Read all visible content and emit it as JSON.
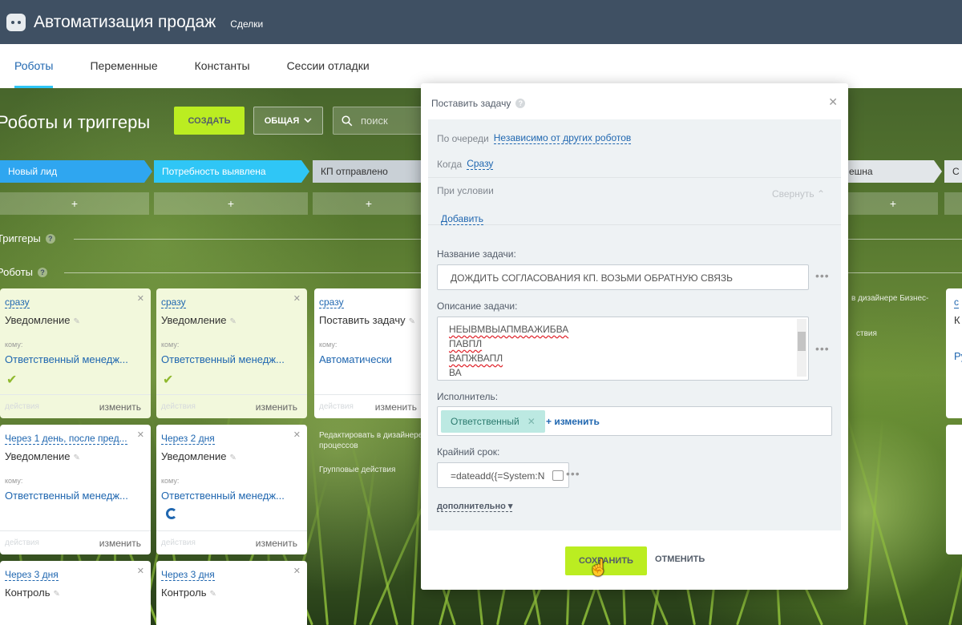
{
  "app": {
    "title": "Автоматизация продаж",
    "section": "Сделки"
  },
  "tabs": [
    {
      "label": "Роботы"
    },
    {
      "label": "Переменные"
    },
    {
      "label": "Константы"
    },
    {
      "label": "Сессии отладки"
    }
  ],
  "toolbar": {
    "page_title": "Роботы и триггеры",
    "create_label": "СОЗДАТЬ",
    "common_label": "ОБЩАЯ",
    "search_placeholder": "поиск"
  },
  "stages": [
    {
      "label": "Новый лид",
      "color": "#2fa6f0"
    },
    {
      "label": "Потребность выявлена",
      "color": "#2fc6f6"
    },
    {
      "label": "КП отправлено",
      "color": "#c9d0d6"
    },
    {
      "label": "ешна",
      "color": "#e2e6e9"
    },
    {
      "label": "С",
      "color": "#e2e6e9"
    }
  ],
  "plus_label": "+",
  "sections": {
    "triggers": "Триггеры",
    "robots": "Роботы"
  },
  "cards": [
    {
      "when": "сразу",
      "name": "Уведомление",
      "to": "кому:",
      "resp": "Ответственный менедж...",
      "acts": "действия",
      "edit": "изменить"
    },
    {
      "when": "сразу",
      "name": "Уведомление",
      "to": "кому:",
      "resp": "Ответственный менедж...",
      "acts": "действия",
      "edit": "изменить"
    },
    {
      "when": "сразу",
      "name": "Поставить задачу",
      "to": "кому:",
      "resp": "Автоматически",
      "acts": "действия",
      "edit": "изменить"
    },
    {
      "when": "Через 1 день, после пред...",
      "name": "Уведомление",
      "to": "кому:",
      "resp": "Ответственный менедж...",
      "acts": "действия",
      "edit": "изменить"
    },
    {
      "when": "Через 2 дня",
      "name": "Уведомление",
      "to": "кому:",
      "resp": "Ответственный менедж...",
      "acts": "действия",
      "edit": "изменить"
    },
    {
      "when": "Через 3 дня",
      "name": "Контроль"
    },
    {
      "when": "Через 3 дня",
      "name": "Контроль"
    }
  ],
  "side": {
    "edit_designer": "Редактировать в дизайнере процессов",
    "group_actions": "Групповые действия",
    "right_designer": "в дизайнере Бизнес-",
    "right_actions": "ствия"
  },
  "right_card": {
    "when": "с",
    "name": "К",
    "resp": "Ру"
  },
  "modal": {
    "title": "Поставить задачу",
    "queue_label": "По очереди",
    "queue_value": "Независимо от других роботов",
    "when_label": "Когда",
    "when_value": "Сразу",
    "condition_label": "При условии",
    "collapse_label": "Свернуть",
    "add_label": "Добавить",
    "task_name_label": "Название задачи:",
    "task_name_value": "ДОЖДИТЬ СОГЛАСОВАНИЯ КП. ВОЗЬМИ ОБРАТНУЮ СВЯЗЬ",
    "description_label": "Описание задачи:",
    "description_lines": [
      "НЕЫВМВЫАПМВАЖИБВА",
      "ПАВПЛ",
      "ВАПЖВАПЛ",
      "ВА"
    ],
    "executor_label": "Исполнитель:",
    "executor_value": "Ответственный",
    "change_label": "+ изменить",
    "deadline_label": "Крайний срок:",
    "deadline_value": "=dateadd({=System:N",
    "more_label": "дополнительно",
    "save_label": "СОХРАНИТЬ",
    "cancel_label": "ОТМЕНИТЬ"
  },
  "colors": {
    "accent_green": "#bbed21",
    "link_blue": "#2067b0",
    "topbar": "#3f5063"
  }
}
